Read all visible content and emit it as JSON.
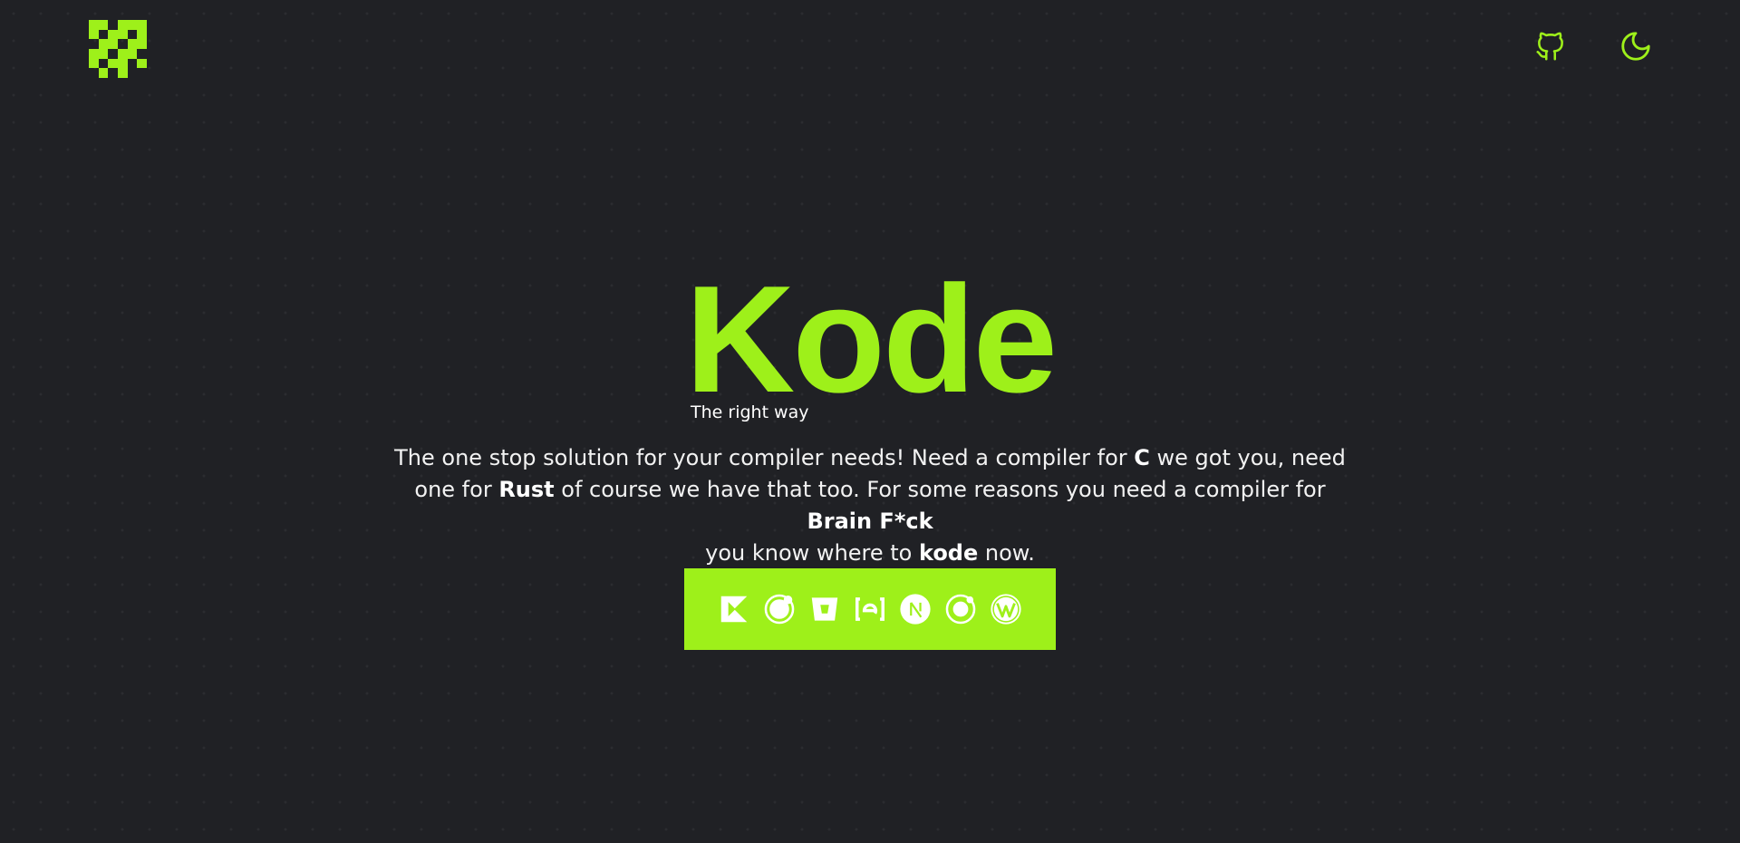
{
  "brand": {
    "logo_icon": "pixel-logo-icon",
    "accent": "#9ef01a",
    "background": "#202125"
  },
  "header": {
    "github_icon": "github-icon",
    "theme_icon": "moon-icon"
  },
  "hero": {
    "title": "Kode",
    "subtitle": "The right way",
    "description": {
      "part1": "The one stop solution for your compiler needs! Need a compiler for ",
      "bold1": "C",
      "part2": " we got you, need one for ",
      "bold2": "Rust",
      "part3": " of course we have that too. For some reasons you need a compiler for ",
      "bold3": "Brain F*ck",
      "part4": " you know where to ",
      "bold4": "kode",
      "part5": " now."
    }
  },
  "languages": [
    {
      "icon": "kotlin-icon"
    },
    {
      "icon": "orb-icon"
    },
    {
      "icon": "bucket-icon"
    },
    {
      "icon": "brackets-e-icon"
    },
    {
      "icon": "nextjs-icon"
    },
    {
      "icon": "ionic-icon"
    },
    {
      "icon": "wordpress-icon"
    }
  ]
}
